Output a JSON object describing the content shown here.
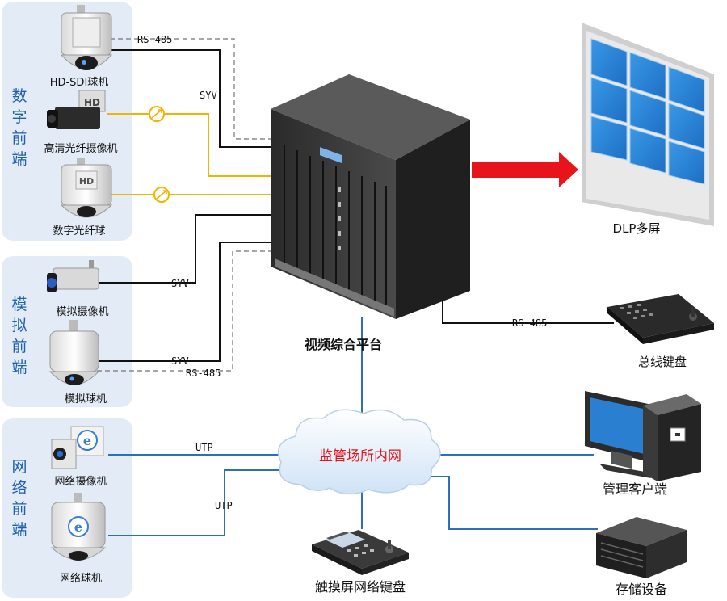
{
  "groups": {
    "digital": [
      "数",
      "字",
      "前",
      "端"
    ],
    "analog": [
      "模",
      "拟",
      "前",
      "端"
    ],
    "network": [
      "网",
      "络",
      "前",
      "端"
    ]
  },
  "devices": {
    "hd_sdi_dome": "HD-SDI球机",
    "hd_fiber_camera": "高清光纤摄像机",
    "digital_fiber_dome": "数字光纤球",
    "analog_camera": "模拟摄像机",
    "analog_dome": "模拟球机",
    "network_camera": "网络摄像机",
    "network_dome": "网络球机"
  },
  "center": {
    "platform": "视频综合平台",
    "network_cloud": "监管场所内网"
  },
  "outputs": {
    "dlp_wall": "DLP多屏",
    "bus_keyboard": "总线键盘",
    "management_client": "管理客户端",
    "storage": "存储设备",
    "touch_keyboard": "触摸屏网络键盘"
  },
  "line_labels": {
    "rs485_top": "RS-485",
    "syv_top": "SYV",
    "syv_analog_cam": "SYV",
    "syv_analog_dome": "SYV",
    "rs485_analog": "RS-485",
    "rs485_keyboard": "RS-485",
    "utp_camera": "UTP",
    "utp_dome": "UTP"
  },
  "icons": {
    "hd_badge": "HD"
  },
  "colors": {
    "panel_bg": "#e3ecf6",
    "group_label": "#1f5fb0",
    "fiber_line": "#f2b400",
    "network_line": "#2e6fb8",
    "signal_arrow": "#e8141b",
    "cloud_text": "#e8141b",
    "screen_blue": "#2a7fd0"
  }
}
